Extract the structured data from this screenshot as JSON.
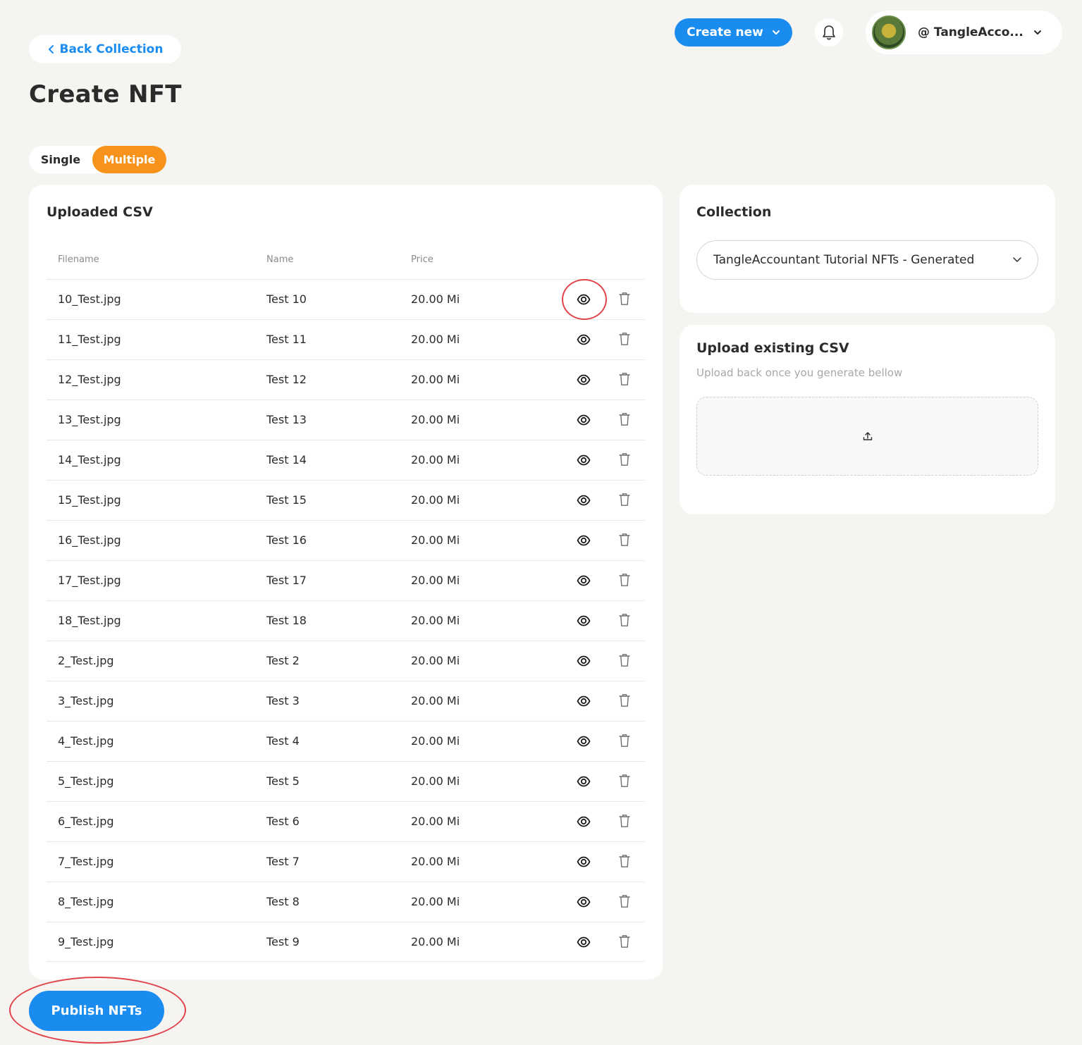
{
  "header": {
    "back_label": "Back Collection",
    "create_new_label": "Create new",
    "username": "@ TangleAcco..."
  },
  "page": {
    "title": "Create NFT"
  },
  "mode_toggle": {
    "single_label": "Single",
    "multiple_label": "Multiple",
    "selected": "Multiple"
  },
  "csv_table": {
    "title": "Uploaded CSV",
    "columns": [
      "Filename",
      "Name",
      "Price"
    ],
    "rows": [
      {
        "filename": "10_Test.jpg",
        "name": "Test 10",
        "price": "20.00 Mi"
      },
      {
        "filename": "11_Test.jpg",
        "name": "Test 11",
        "price": "20.00 Mi"
      },
      {
        "filename": "12_Test.jpg",
        "name": "Test 12",
        "price": "20.00 Mi"
      },
      {
        "filename": "13_Test.jpg",
        "name": "Test 13",
        "price": "20.00 Mi"
      },
      {
        "filename": "14_Test.jpg",
        "name": "Test 14",
        "price": "20.00 Mi"
      },
      {
        "filename": "15_Test.jpg",
        "name": "Test 15",
        "price": "20.00 Mi"
      },
      {
        "filename": "16_Test.jpg",
        "name": "Test 16",
        "price": "20.00 Mi"
      },
      {
        "filename": "17_Test.jpg",
        "name": "Test 17",
        "price": "20.00 Mi"
      },
      {
        "filename": "18_Test.jpg",
        "name": "Test 18",
        "price": "20.00 Mi"
      },
      {
        "filename": "2_Test.jpg",
        "name": "Test 2",
        "price": "20.00 Mi"
      },
      {
        "filename": "3_Test.jpg",
        "name": "Test 3",
        "price": "20.00 Mi"
      },
      {
        "filename": "4_Test.jpg",
        "name": "Test 4",
        "price": "20.00 Mi"
      },
      {
        "filename": "5_Test.jpg",
        "name": "Test 5",
        "price": "20.00 Mi"
      },
      {
        "filename": "6_Test.jpg",
        "name": "Test 6",
        "price": "20.00 Mi"
      },
      {
        "filename": "7_Test.jpg",
        "name": "Test 7",
        "price": "20.00 Mi"
      },
      {
        "filename": "8_Test.jpg",
        "name": "Test 8",
        "price": "20.00 Mi"
      },
      {
        "filename": "9_Test.jpg",
        "name": "Test 9",
        "price": "20.00 Mi"
      }
    ]
  },
  "collection": {
    "title": "Collection",
    "selected_value": "TangleAccountant Tutorial NFTs - Generated"
  },
  "upload": {
    "title": "Upload existing CSV",
    "subtitle": "Upload back once you generate bellow"
  },
  "publish_label": "Publish NFTs",
  "colors": {
    "accent_blue": "#1a8cf0",
    "accent_orange": "#f7931a",
    "highlight_red": "#e0444a",
    "background": "#f5f4f0"
  },
  "icons": [
    "chevron-left-icon",
    "chevron-down-icon",
    "bell-icon",
    "eye-icon",
    "trash-icon",
    "upload-icon"
  ]
}
